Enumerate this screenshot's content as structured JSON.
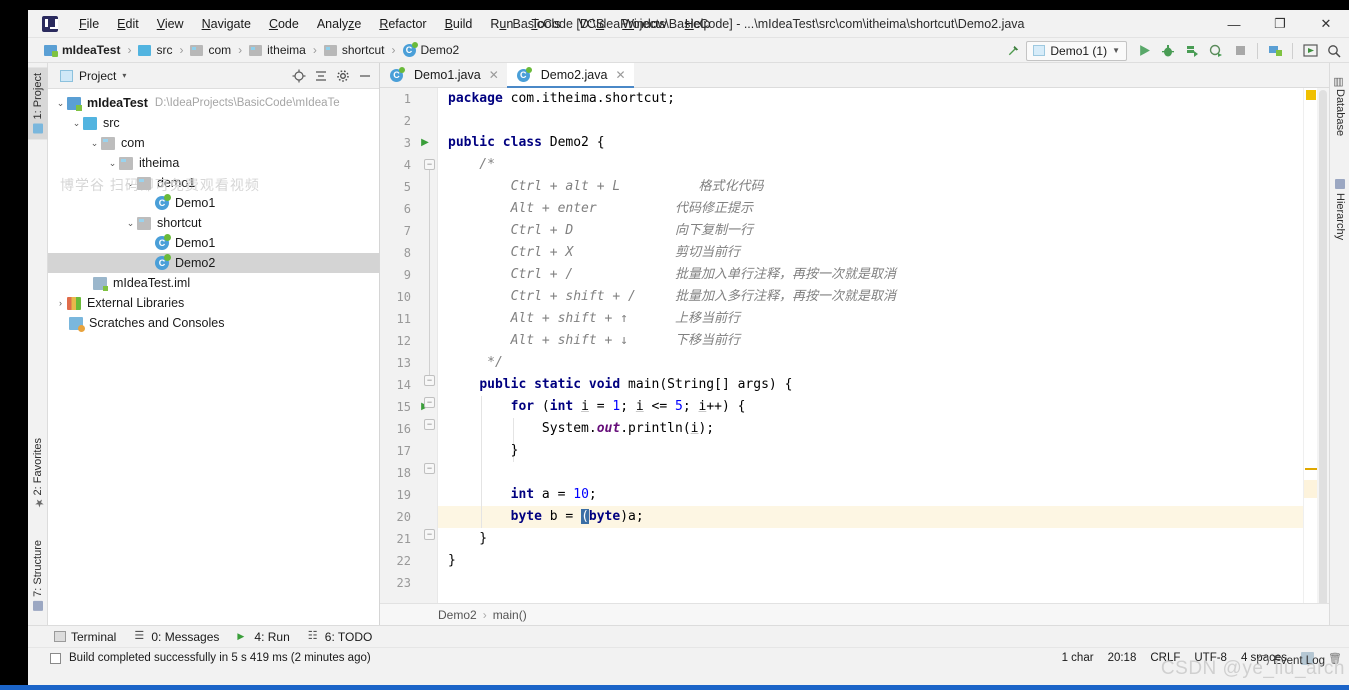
{
  "window": {
    "title": "BasicCode [D:\\IdeaProjects\\BasicCode] - ...\\mIdeaTest\\src\\com\\itheima\\shortcut\\Demo2.java",
    "minimize": "—",
    "maximize": "❐",
    "close": "✕"
  },
  "menu": [
    {
      "label": "File"
    },
    {
      "label": "Edit"
    },
    {
      "label": "View"
    },
    {
      "label": "Navigate"
    },
    {
      "label": "Code"
    },
    {
      "label": "Analyze"
    },
    {
      "label": "Refactor"
    },
    {
      "label": "Build"
    },
    {
      "label": "Run"
    },
    {
      "label": "Tools"
    },
    {
      "label": "VCS"
    },
    {
      "label": "Window"
    },
    {
      "label": "Help"
    }
  ],
  "navbar": {
    "crumbs": [
      {
        "label": "mIdeaTest",
        "icon": "module-icon"
      },
      {
        "label": "src",
        "icon": "source-folder-icon"
      },
      {
        "label": "com",
        "icon": "package-icon"
      },
      {
        "label": "itheima",
        "icon": "package-icon"
      },
      {
        "label": "shortcut",
        "icon": "package-icon"
      },
      {
        "label": "Demo2",
        "icon": "java-class-icon"
      }
    ],
    "separator": "›",
    "run_config": "Demo1 (1)",
    "toolbar_icons": [
      "hammer-build-icon",
      "run-icon",
      "debug-icon",
      "run-with-coverage-icon",
      "profile-icon",
      "stop-icon",
      "project-structure-icon",
      "update-icon",
      "search-icon"
    ]
  },
  "left_strip": {
    "top": [
      {
        "label": "1: Project",
        "icon": "project-icon",
        "active": true
      }
    ],
    "bottom": [
      {
        "label": "2: Favorites",
        "icon": "star-icon"
      },
      {
        "label": "7: Structure",
        "icon": "structure-icon"
      }
    ]
  },
  "right_strip": [
    {
      "label": "Database",
      "icon": "database-icon"
    },
    {
      "label": "Hierarchy",
      "icon": "hierarchy-icon"
    }
  ],
  "project_panel": {
    "title": "Project",
    "dropdown": "▾",
    "actions": [
      "locate-icon",
      "collapse-all-icon",
      "settings-gear-icon",
      "hide-icon"
    ],
    "watermark": "博学谷 扫码即可免费观看视频",
    "tree": [
      {
        "depth": 0,
        "twisty": "⌄",
        "icon": "module-icon",
        "label": "mIdeaTest",
        "bold": true,
        "path": "D:\\IdeaProjects\\BasicCode\\mIdeaTe",
        "selected": false
      },
      {
        "depth": 1,
        "twisty": "⌄",
        "icon": "source-folder-icon",
        "label": "src",
        "bold": false,
        "path": "",
        "selected": false
      },
      {
        "depth": 2,
        "twisty": "⌄",
        "icon": "package-icon",
        "label": "com",
        "bold": false,
        "path": "",
        "selected": false
      },
      {
        "depth": 3,
        "twisty": "⌄",
        "icon": "package-icon",
        "label": "itheima",
        "bold": false,
        "path": "",
        "selected": false
      },
      {
        "depth": 4,
        "twisty": "⌄",
        "icon": "package-icon",
        "label": "demo1",
        "bold": false,
        "path": "",
        "selected": false
      },
      {
        "depth": 5,
        "twisty": "",
        "icon": "java-class-icon",
        "label": "Demo1",
        "bold": false,
        "path": "",
        "selected": false
      },
      {
        "depth": 4,
        "twisty": "⌄",
        "icon": "package-icon",
        "label": "shortcut",
        "bold": false,
        "path": "",
        "selected": false
      },
      {
        "depth": 5,
        "twisty": "",
        "icon": "java-class-icon",
        "label": "Demo1",
        "bold": false,
        "path": "",
        "selected": false
      },
      {
        "depth": 5,
        "twisty": "",
        "icon": "java-class-icon",
        "label": "Demo2",
        "bold": false,
        "path": "",
        "selected": true
      },
      {
        "depth": 2,
        "twisty": "",
        "icon": "iml-file-icon",
        "label": "mIdeaTest.iml",
        "bold": false,
        "path": "",
        "selected": false
      },
      {
        "depth": 0,
        "twisty": "›",
        "icon": "library-icon",
        "label": "External Libraries",
        "bold": false,
        "path": "",
        "selected": false
      },
      {
        "depth": 0,
        "twisty": "",
        "icon": "scratches-icon",
        "label": "Scratches and Consoles",
        "bold": false,
        "path": "",
        "selected": false
      }
    ]
  },
  "editor": {
    "tabs": [
      {
        "label": "Demo1.java",
        "active": false,
        "close": "✕"
      },
      {
        "label": "Demo2.java",
        "active": true,
        "close": "✕"
      }
    ],
    "breadcrumb": [
      "Demo2",
      "main()"
    ],
    "breadcrumb_sep": "›",
    "line_count": 23,
    "lines": [
      {
        "n": 1,
        "text": "package com.itheima.shortcut;"
      },
      {
        "n": 2,
        "text": ""
      },
      {
        "n": 3,
        "text": "public class Demo2 {"
      },
      {
        "n": 4,
        "text": "    /*"
      },
      {
        "n": 5,
        "text": "        Ctrl + alt + L          格式化代码"
      },
      {
        "n": 6,
        "text": "        Alt + enter          代码修正提示"
      },
      {
        "n": 7,
        "text": "        Ctrl + D             向下复制一行"
      },
      {
        "n": 8,
        "text": "        Ctrl + X             剪切当前行"
      },
      {
        "n": 9,
        "text": "        Ctrl + /             批量加入单行注释，再按一次就是取消"
      },
      {
        "n": 10,
        "text": "        Ctrl + shift + /     批量加入多行注释，再按一次就是取消"
      },
      {
        "n": 11,
        "text": "        Alt + shift + ↑      上移当前行"
      },
      {
        "n": 12,
        "text": "        Alt + shift + ↓      下移当前行"
      },
      {
        "n": 13,
        "text": "     */"
      },
      {
        "n": 14,
        "text": "    public static void main(String[] args) {"
      },
      {
        "n": 15,
        "text": "        for (int i = 1; i <= 5; i++) {"
      },
      {
        "n": 16,
        "text": "            System.out.println(i);"
      },
      {
        "n": 17,
        "text": "        }"
      },
      {
        "n": 18,
        "text": ""
      },
      {
        "n": 19,
        "text": "        int a = 10;"
      },
      {
        "n": 20,
        "text": "        byte b = (byte)a;"
      },
      {
        "n": 21,
        "text": "    }"
      },
      {
        "n": 22,
        "text": "}"
      },
      {
        "n": 23,
        "text": ""
      }
    ],
    "highlighted_line": 20,
    "run_gutter_lines": [
      3,
      14
    ]
  },
  "bottom_tools": [
    {
      "label": "Terminal",
      "mnemonic": "",
      "icon": "terminal-icon"
    },
    {
      "label": "0: Messages",
      "mnemonic": "0",
      "icon": "messages-icon"
    },
    {
      "label": "4: Run",
      "mnemonic": "4",
      "icon": "run-icon"
    },
    {
      "label": "6: TODO",
      "mnemonic": "6",
      "icon": "todo-icon"
    }
  ],
  "status": {
    "message": "Build completed successfully in 5 s 419 ms (2 minutes ago)",
    "event_log": "Event Log",
    "chars": "1 char",
    "caret": "20:18",
    "line_sep": "CRLF",
    "encoding": "UTF-8",
    "indent": "4 spaces",
    "watermark": "CSDN @ye_liu_arch"
  },
  "colors": {
    "accent": "#4a88c7",
    "keyword": "#000080",
    "comment": "#808080",
    "number": "#0000ff",
    "field": "#660e7a",
    "selection": "#3a6ea5",
    "highlight_row": "#fdf6e3",
    "warn_marker": "#f0c000"
  }
}
